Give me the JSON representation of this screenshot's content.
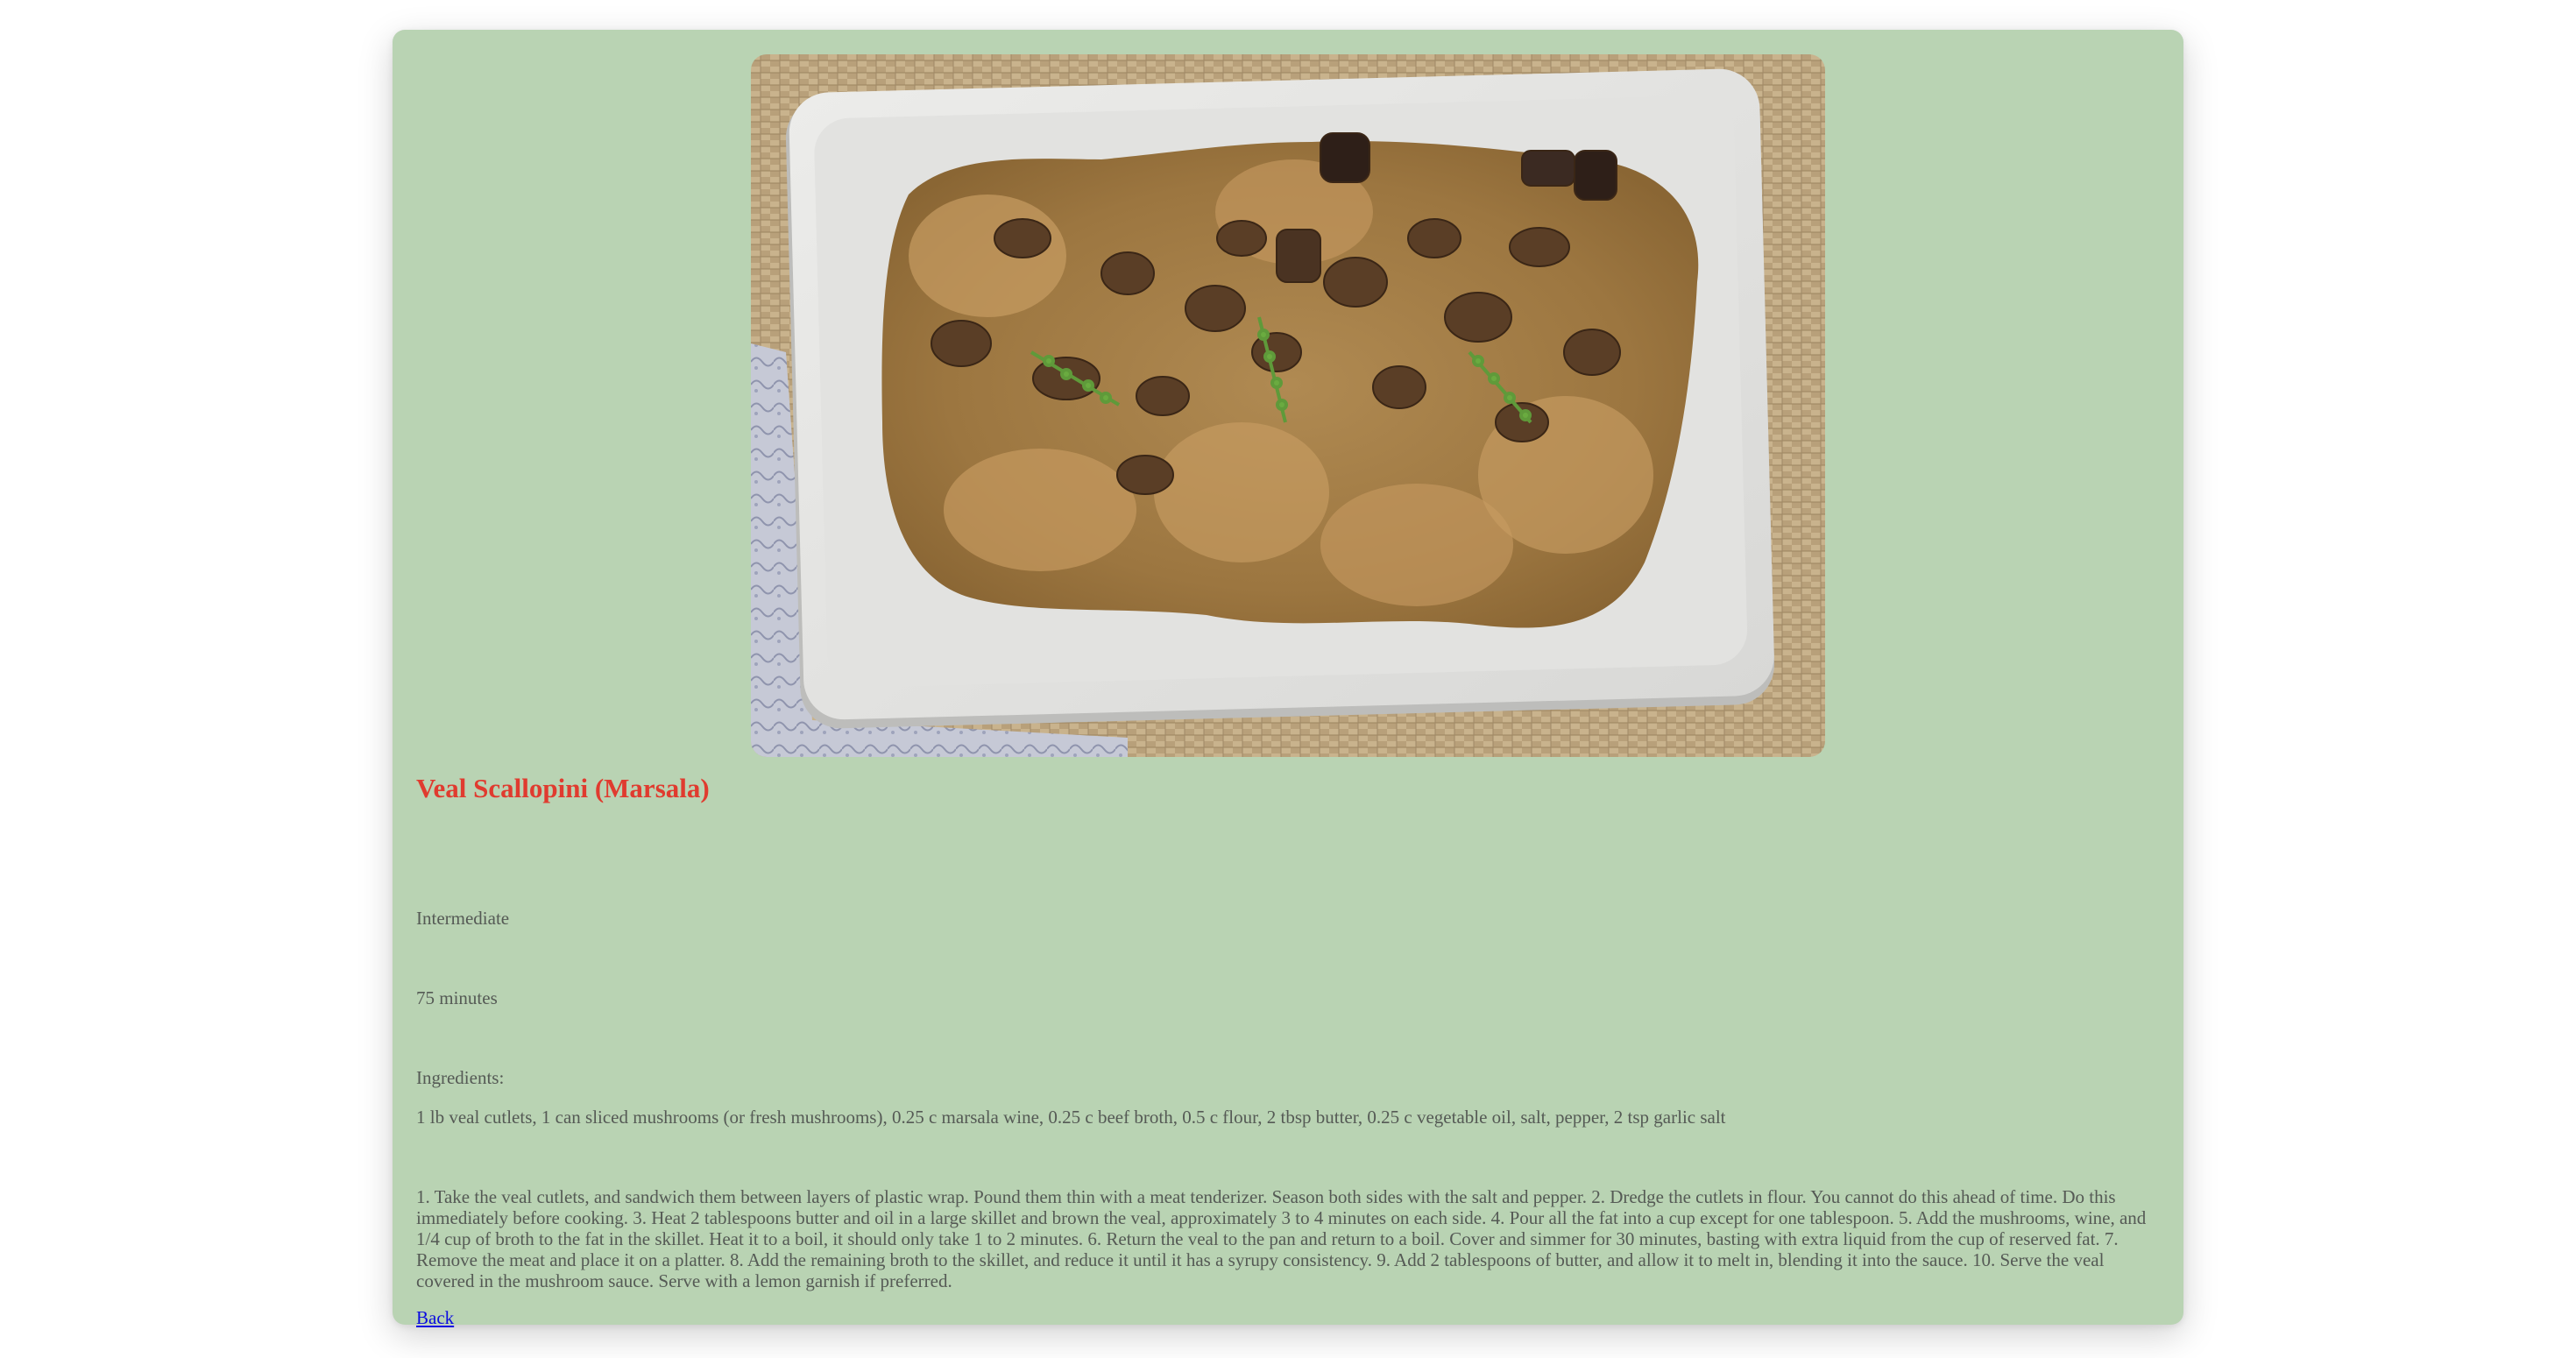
{
  "recipe": {
    "title": "Veal Scallopini (Marsala)",
    "difficulty": "Intermediate",
    "time": "75 minutes",
    "ingredients_label": "Ingredients:",
    "ingredients": "1 lb veal cutlets, 1 can sliced mushrooms (or fresh mushrooms), 0.25 c marsala wine, 0.25 c beef broth, 0.5 c flour, 2 tbsp butter, 0.25 c vegetable oil, salt, pepper, 2 tsp garlic salt",
    "instructions": "1. Take the veal cutlets, and sandwich them between layers of plastic wrap. Pound them thin with a meat tenderizer. Season both sides with the salt and pepper. 2. Dredge the cutlets in flour. You cannot do this ahead of time. Do this immediately before cooking. 3. Heat 2 tablespoons butter and oil in a large skillet and brown the veal, approximately 3 to 4 minutes on each side. 4. Pour all the fat into a cup except for one tablespoon. 5. Add the mushrooms, wine, and 1/4 cup of broth to the fat in the skillet. Heat it to a boil, it should only take 1 to 2 minutes. 6. Return the veal to the pan and return to a boil. Cover and simmer for 30 minutes, basting with extra liquid from the cup of reserved fat. 7. Remove the meat and place it on a platter. 8. Add the remaining broth to the skillet, and reduce it until it has a syrupy consistency. 9. Add 2 tablespoons of butter, and allow it to melt in, blending it into the sauce. 10. Serve the veal covered in the mushroom sauce. Serve with a lemon garnish if preferred."
  },
  "nav": {
    "back_label": "Back"
  },
  "colors": {
    "page_bg": "#ffffff",
    "card_bg": "#b9d3b3",
    "title": "#e03b2f",
    "body_text": "#555a55",
    "link": "#0a0ae0"
  }
}
